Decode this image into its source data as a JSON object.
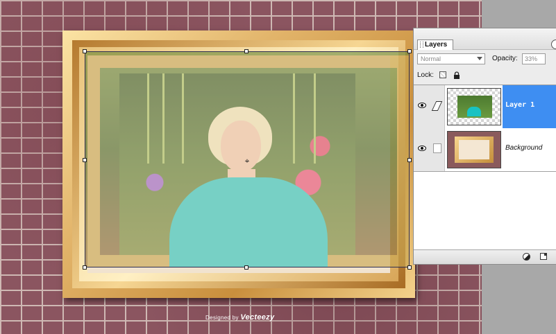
{
  "canvas": {
    "watermark_prefix": "Designed by",
    "watermark_brand": "Vecteezy"
  },
  "layers_panel": {
    "tab_label": "Layers",
    "blend_mode": "Normal",
    "opacity_label": "Opacity:",
    "opacity_value": "33%",
    "lock_label": "Lock:",
    "layers": [
      {
        "name": "Layer 1",
        "selected": true,
        "visible": true
      },
      {
        "name": "Background",
        "selected": false,
        "visible": true
      }
    ]
  },
  "icons": {
    "visibility": "eye-icon",
    "brush": "brush-icon",
    "lock_transparency": "checkerboard-lock-icon",
    "lock_all": "padlock-icon",
    "adjustment": "half-circle-icon",
    "new_layer": "new-layer-icon"
  },
  "colors": {
    "selection_highlight": "#3e8ef2",
    "shirt": "#2ec6c0",
    "frame_gold": "#e2b46a",
    "brick": "#8b5560"
  }
}
